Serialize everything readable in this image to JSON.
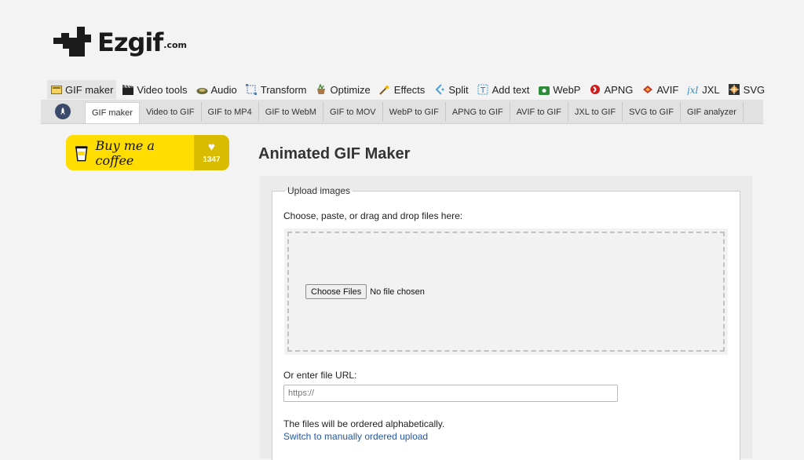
{
  "logo": {
    "name": "Ezgif",
    "tld": ".com"
  },
  "main_nav": [
    {
      "label": "GIF maker",
      "icon": "gif-maker-icon",
      "active": true
    },
    {
      "label": "Video tools",
      "icon": "clapperboard-icon"
    },
    {
      "label": "Audio",
      "icon": "audio-icon"
    },
    {
      "label": "Transform",
      "icon": "transform-icon"
    },
    {
      "label": "Optimize",
      "icon": "optimize-icon"
    },
    {
      "label": "Effects",
      "icon": "effects-wand-icon"
    },
    {
      "label": "Split",
      "icon": "split-icon"
    },
    {
      "label": "Add text",
      "icon": "add-text-icon"
    },
    {
      "label": "WebP",
      "icon": "webp-icon"
    },
    {
      "label": "APNG",
      "icon": "apng-icon"
    },
    {
      "label": "AVIF",
      "icon": "avif-icon"
    },
    {
      "label": "JXL",
      "icon": "jxl-icon"
    },
    {
      "label": "SVG",
      "icon": "svg-icon"
    }
  ],
  "sub_nav": [
    {
      "label": "GIF maker",
      "active": true
    },
    {
      "label": "Video to GIF"
    },
    {
      "label": "GIF to MP4"
    },
    {
      "label": "GIF to WebM"
    },
    {
      "label": "GIF to MOV"
    },
    {
      "label": "WebP to GIF"
    },
    {
      "label": "APNG to GIF"
    },
    {
      "label": "AVIF to GIF"
    },
    {
      "label": "JXL to GIF"
    },
    {
      "label": "SVG to GIF"
    },
    {
      "label": "GIF analyzer"
    }
  ],
  "coffee": {
    "label": "Buy me a coffee",
    "count": "1347"
  },
  "page_title": "Animated GIF Maker",
  "upload": {
    "legend": "Upload images",
    "choose_label": "Choose, paste, or drag and drop files here:",
    "choose_button": "Choose Files",
    "no_file": "No file chosen",
    "url_label": "Or enter file URL:",
    "url_placeholder": "https://",
    "note": "The files will be ordered alphabetically.",
    "switch_link": "Switch to manually ordered upload"
  },
  "colors": {
    "coffee_yellow": "#ffdd00",
    "link_blue": "#2457a6",
    "home_icon": "#3b4a6b"
  }
}
